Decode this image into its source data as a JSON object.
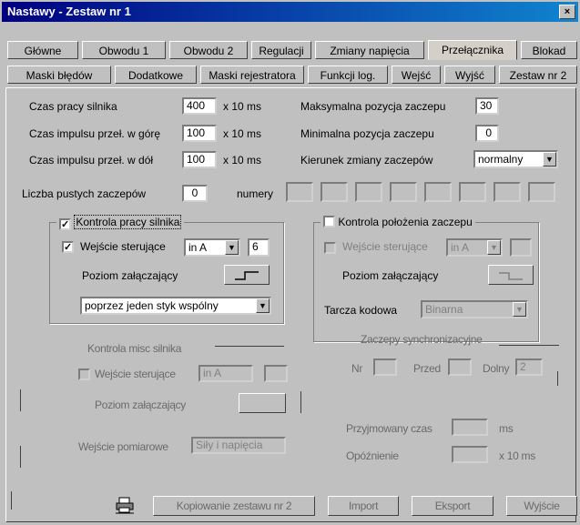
{
  "window": {
    "title": "Nastawy  -  Zestaw nr 1",
    "close": "×"
  },
  "tabs_row1": [
    "Główne",
    "Obwodu 1",
    "Obwodu 2",
    "Regulacji",
    "Zmiany napięcia",
    "Przełącznika",
    "Blokad"
  ],
  "tabs_row2": [
    "Maski błędów",
    "Dodatkowe",
    "Maski rejestratora",
    "Funkcji log.",
    "Wejść",
    "Wyjść",
    "Zestaw nr 2"
  ],
  "active_tab": "Przełącznika",
  "fields": {
    "czas_pracy": {
      "label": "Czas pracy silnika",
      "value": "400",
      "unit": "x 10 ms"
    },
    "czas_gore": {
      "label": "Czas impulsu przeł. w górę",
      "value": "100",
      "unit": "x 10 ms"
    },
    "czas_dol": {
      "label": "Czas impulsu przeł. w dół",
      "value": "100",
      "unit": "x 10 ms"
    },
    "max_poz": {
      "label": "Maksymalna pozycja zaczepu",
      "value": "30"
    },
    "min_poz": {
      "label": "Minimalna pozycja zaczepu",
      "value": "0"
    },
    "kierunek": {
      "label": "Kierunek zmiany zaczepów",
      "value": "normalny"
    },
    "pustych": {
      "label": "Liczba pustych zaczepów",
      "value": "0",
      "numery_label": "numery"
    }
  },
  "group_kontrola_pracy": {
    "title": "Kontrola pracy silnika",
    "checked": "✓",
    "wejscie_label": "Wejście sterujące",
    "wejscie_checked": "✓",
    "combo": "in A",
    "num": "6",
    "poziom_label": "Poziom załączający",
    "tryb": "poprzez jeden styk wspólny"
  },
  "group_kontrola_polozenia": {
    "title": "Kontrola położenia zaczepu",
    "wejscie_label": "Wejście sterujące",
    "combo": "in A",
    "poziom_label": "Poziom załączający",
    "tarcza_label": "Tarcza kodowa",
    "tarcza_value": "Binarna"
  },
  "ghost": {
    "zaczepy": "Zaczepy synchronizacyjne",
    "nr": "Nr",
    "przed": "Przed",
    "dolny": "Dolny",
    "dolny_val": "2",
    "kontrola_misc": "Kontrola misc silnika",
    "wejscie": "Wejście sterujące",
    "wejscie_val": "in A",
    "poziom": "Poziom załączający",
    "wejscie_pom": "Wejście pomiarowe",
    "wejscie_pom_val": "Siły i napięcia",
    "przyjmowany": "Przyjmowany czas",
    "ms": "ms",
    "opoznienie": "Opóźnienie",
    "x10ms": "x 10 ms"
  },
  "buttons": {
    "kopiuj": "Kopiowanie zestawu nr 2",
    "import": "Import",
    "eksport": "Eksport",
    "wyjscie": "Wyjście"
  },
  "icons": {
    "printer": "printer-icon",
    "step": "step-signal-icon"
  }
}
